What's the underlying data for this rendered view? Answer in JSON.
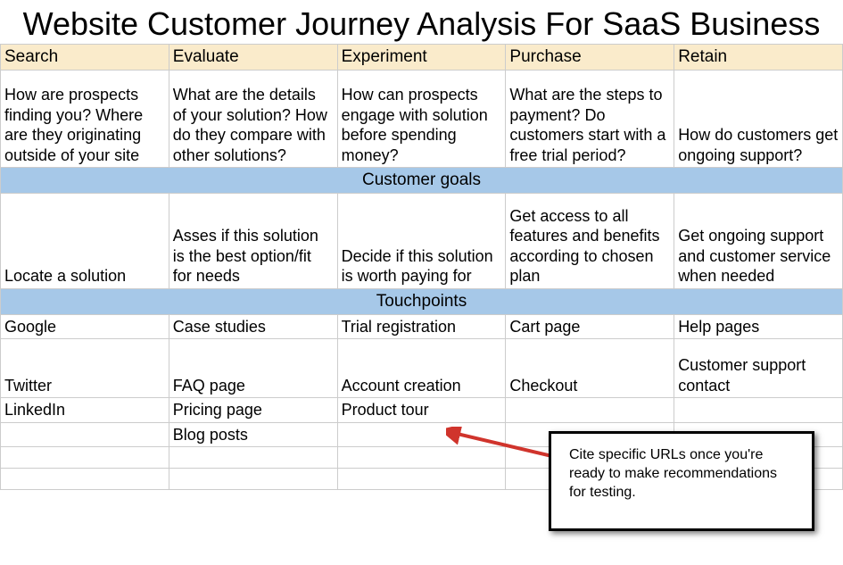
{
  "title": "Website Customer Journey Analysis For SaaS Business",
  "stages": [
    "Search",
    "Evaluate",
    "Experiment",
    "Purchase",
    "Retain"
  ],
  "questions": [
    "How are prospects finding you? Where are they originating outside of your site",
    "What are the details of your solution? How do they compare with other solutions?",
    "How can prospects engage with solution before spending money?",
    "What are the steps to payment? Do customers start with a free trial period?",
    "How do customers get ongoing support?"
  ],
  "section_goals": "Customer goals",
  "goals": [
    "Locate a solution",
    "Asses if this solution is the best option/fit for needs",
    "Decide if this solution is worth paying for",
    "Get access to all features and benefits according to chosen plan",
    "Get ongoing support and customer service when needed"
  ],
  "section_touchpoints": "Touchpoints",
  "touchpoints": [
    [
      "Google",
      "Case studies",
      "Trial registration",
      "Cart page",
      "Help pages"
    ],
    [
      "Twitter",
      "FAQ page",
      "Account creation",
      "Checkout",
      "Customer support contact"
    ],
    [
      "LinkedIn",
      "Pricing page",
      "Product tour",
      "",
      ""
    ],
    [
      "",
      "Blog posts",
      "",
      "",
      ""
    ],
    [
      "",
      "",
      "",
      "",
      ""
    ]
  ],
  "note": "Cite specific URLs once you're ready to make recommendations for testing."
}
